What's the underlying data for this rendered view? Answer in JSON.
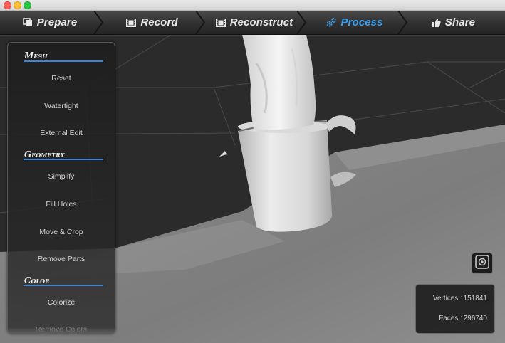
{
  "tabs": [
    {
      "label": "Prepare",
      "icon": "prepare-icon",
      "active": false
    },
    {
      "label": "Record",
      "icon": "film-icon",
      "active": false
    },
    {
      "label": "Reconstruct",
      "icon": "film-icon",
      "active": false
    },
    {
      "label": "Process",
      "icon": "gears-icon",
      "active": true
    },
    {
      "label": "Share",
      "icon": "thumbs-up-icon",
      "active": false
    }
  ],
  "panel": {
    "mesh": {
      "title": "Mesh",
      "items": [
        "Reset",
        "Watertight",
        "External Edit"
      ]
    },
    "geometry": {
      "title": "Geometry",
      "items": [
        "Simplify",
        "Fill Holes",
        "Move & Crop",
        "Remove Parts"
      ]
    },
    "color": {
      "title": "Color",
      "items": [
        "Colorize",
        "Remove Colors"
      ]
    }
  },
  "stats": {
    "vertices_label": "Vertices :",
    "vertices_value": "151841",
    "faces_label": "Faces :",
    "faces_value": "296740"
  },
  "colors": {
    "accent": "#3aa0f0",
    "section_underline": "#3a86d8",
    "background": "#2b2b2b"
  }
}
